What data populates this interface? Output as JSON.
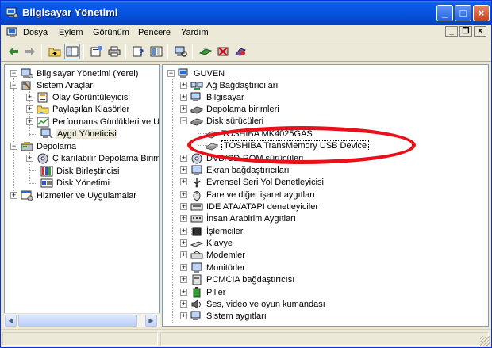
{
  "window": {
    "title": "Bilgisayar Yönetimi",
    "minimize_label": "_",
    "maximize_label": "□",
    "close_label": "×"
  },
  "menu": {
    "items": [
      "Dosya",
      "Eylem",
      "Görünüm",
      "Pencere",
      "Yardım"
    ]
  },
  "toolbar": {
    "icons": [
      "back-arrow-icon",
      "forward-arrow-icon",
      "up-folder-icon",
      "show-hide-tree-icon",
      "properties-icon",
      "print-icon",
      "help-icon",
      "console-tree-icon",
      "scan-hardware-icon",
      "update-driver-icon",
      "uninstall-icon",
      "disable-icon"
    ]
  },
  "left_tree": {
    "root": "Bilgisayar Yönetimi (Yerel)",
    "system_tools": "Sistem Araçları",
    "event_viewer": "Olay Görüntüleyicisi",
    "shared_folders": "Paylaşılan Klasörler",
    "perf_logs": "Performans Günlükleri ve Uy",
    "device_manager": "Aygıt Yöneticisi",
    "storage": "Depolama",
    "removable_storage": "Çıkarılabilir Depolama Birimi",
    "disk_defrag": "Disk Birleştiricisi",
    "disk_management": "Disk Yönetimi",
    "services_apps": "Hizmetler ve Uygulamalar"
  },
  "right_tree": {
    "root": "GUVEN",
    "categories": [
      "Ağ Bağdaştırıcıları",
      "Bilgisayar",
      "Depolama birimleri",
      "Disk sürücüleri",
      "TOSHIBA MK4025GAS",
      "TOSHIBA TransMemory USB Device",
      "DVD/CD-ROM sürücüleri",
      "Ekran bağdaştırıcıları",
      "Evrensel Seri Yol Denetleyicisi",
      "Fare ve diğer işaret aygıtları",
      "IDE ATA/ATAPI denetleyiciler",
      "İnsan Arabirim Aygıtları",
      "İşlemciler",
      "Klavye",
      "Modemler",
      "Monitörler",
      "PCMCIA bağdaştırıcısı",
      "Piller",
      "Ses, video ve oyun kumandası",
      "Sistem aygıtları"
    ]
  },
  "colors": {
    "titlebar": "#0653e0",
    "highlight_ellipse": "#e8101a",
    "window_bg": "#ece9d8"
  }
}
